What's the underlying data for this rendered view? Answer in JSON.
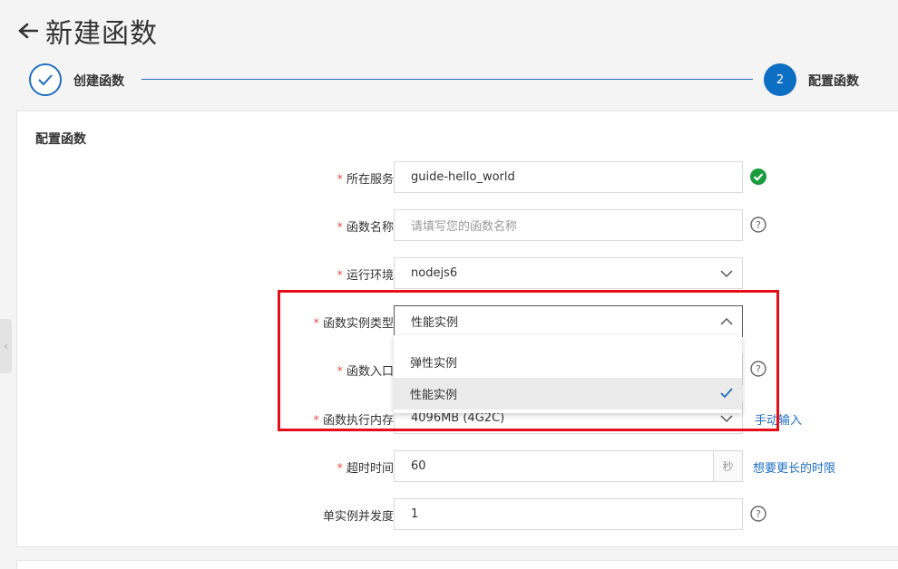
{
  "header": {
    "title": "新建函数"
  },
  "steps": [
    {
      "label": "创建函数",
      "done": true
    },
    {
      "number": "2",
      "label": "配置函数",
      "active": true
    }
  ],
  "card": {
    "title": "配置函数"
  },
  "form": {
    "service": {
      "label": "所在服务",
      "value": "guide-hello_world"
    },
    "func_name": {
      "label": "函数名称",
      "placeholder": "请填写您的函数名称"
    },
    "runtime": {
      "label": "运行环境",
      "value": "nodejs6"
    },
    "instance_type": {
      "label": "函数实例类型",
      "value": "性能实例"
    },
    "handler": {
      "label": "函数入口"
    },
    "memory": {
      "label": "函数执行内存",
      "value": "4096MB (4G2C)",
      "link": "手动输入"
    },
    "timeout": {
      "label": "超时时间",
      "value": "60",
      "unit": "秒",
      "link": "想要更长的时限"
    },
    "concurrency": {
      "label": "单实例并发度",
      "value": "1"
    }
  },
  "dropdown": {
    "options": [
      {
        "label": "弹性实例",
        "selected": false
      },
      {
        "label": "性能实例",
        "selected": true
      }
    ]
  },
  "colors": {
    "accent": "#0d6fc4",
    "required": "#e45447",
    "success": "#1a9b3c",
    "highlight": "#e3101b"
  }
}
